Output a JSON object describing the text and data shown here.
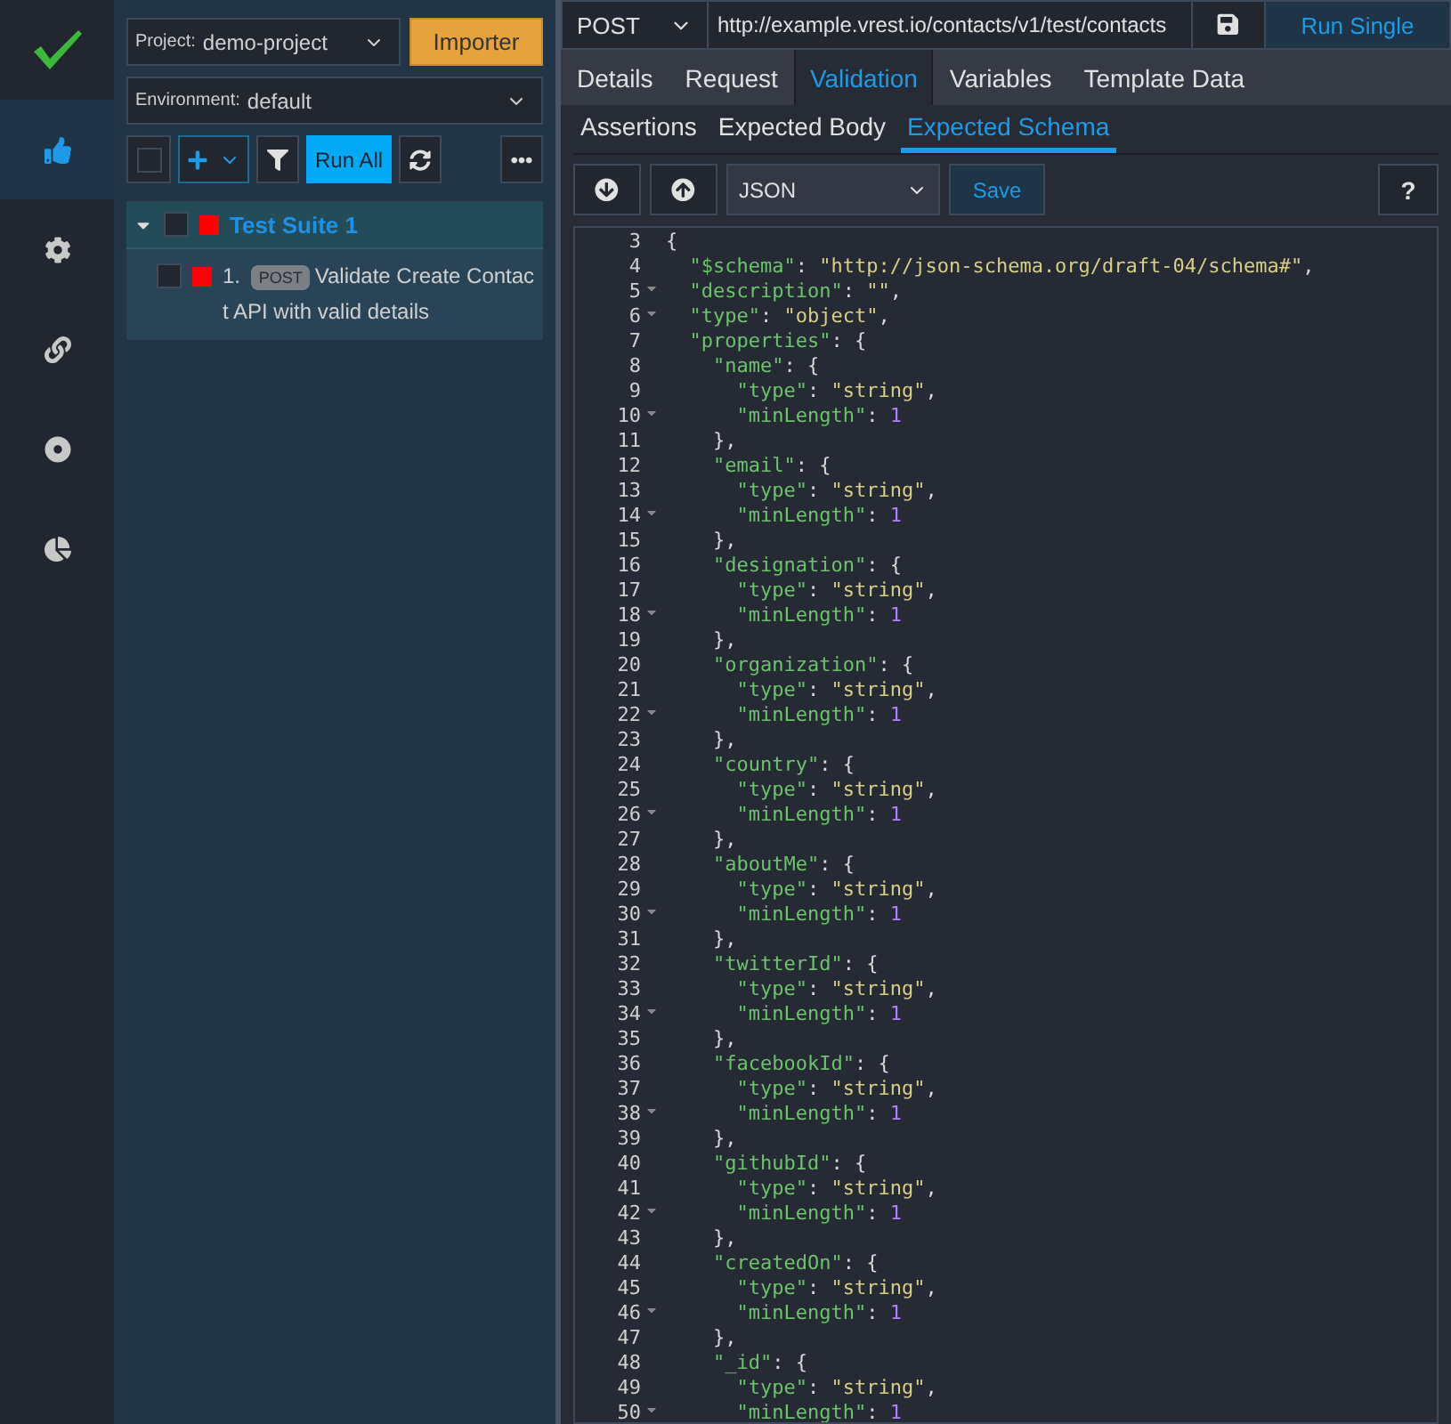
{
  "rail": {
    "items": [
      {
        "kind": "logo",
        "selected": false
      },
      {
        "kind": "thumbs",
        "selected": true
      },
      {
        "kind": "gear",
        "selected": false
      },
      {
        "kind": "link",
        "selected": false
      },
      {
        "kind": "target",
        "selected": false
      },
      {
        "kind": "pie",
        "selected": false
      }
    ]
  },
  "sidebar": {
    "project": {
      "label": "Project:",
      "value": "demo-project"
    },
    "importer": "Importer",
    "environment": {
      "label": "Environment:",
      "value": "default"
    },
    "select_all": {
      "checked": false
    },
    "run_all": "Run All",
    "tree": [
      {
        "label": "Test Suite 1",
        "expanded": true,
        "checked": false,
        "color": "#ff0000",
        "children": [
          {
            "number": "1.",
            "method": "POST",
            "label": "Validate Create Contact API with valid details",
            "checked": false,
            "color": "#ff0000"
          }
        ]
      }
    ]
  },
  "request": {
    "method": "POST",
    "url": "http://example.vrest.io/contacts/v1/test/contacts",
    "run_button": "Run Single"
  },
  "tabs": [
    {
      "label": "Details",
      "selected": false
    },
    {
      "label": "Request",
      "selected": false
    },
    {
      "label": "Validation",
      "selected": true
    },
    {
      "label": "Variables",
      "selected": false
    },
    {
      "label": "Template Data",
      "selected": false
    }
  ],
  "subtabs": [
    {
      "label": "Assertions",
      "selected": false
    },
    {
      "label": "Expected Body",
      "selected": false
    },
    {
      "label": "Expected Schema",
      "selected": true
    }
  ],
  "editor_toolbar": {
    "format": "JSON",
    "save": "Save",
    "help": "?"
  },
  "code": [
    {
      "n": "3",
      "text": "{",
      "fold": false
    },
    {
      "n": "4",
      "text": "  \"$schema\": \"http://json-schema.org/draft-04/schema#\",",
      "fold": false
    },
    {
      "n": "5",
      "text": "  \"description\": \"\",",
      "fold": true
    },
    {
      "n": "6",
      "text": "  \"type\": \"object\",",
      "fold": true
    },
    {
      "n": "7",
      "text": "  \"properties\": {",
      "fold": false
    },
    {
      "n": "8",
      "text": "    \"name\": {",
      "fold": false
    },
    {
      "n": "9",
      "text": "      \"type\": \"string\",",
      "fold": false
    },
    {
      "n": "10",
      "text": "      \"minLength\": 1",
      "fold": true
    },
    {
      "n": "11",
      "text": "    },",
      "fold": false
    },
    {
      "n": "12",
      "text": "    \"email\": {",
      "fold": false
    },
    {
      "n": "13",
      "text": "      \"type\": \"string\",",
      "fold": false
    },
    {
      "n": "14",
      "text": "      \"minLength\": 1",
      "fold": true
    },
    {
      "n": "15",
      "text": "    },",
      "fold": false
    },
    {
      "n": "16",
      "text": "    \"designation\": {",
      "fold": false
    },
    {
      "n": "17",
      "text": "      \"type\": \"string\",",
      "fold": false
    },
    {
      "n": "18",
      "text": "      \"minLength\": 1",
      "fold": true
    },
    {
      "n": "19",
      "text": "    },",
      "fold": false
    },
    {
      "n": "20",
      "text": "    \"organization\": {",
      "fold": false
    },
    {
      "n": "21",
      "text": "      \"type\": \"string\",",
      "fold": false
    },
    {
      "n": "22",
      "text": "      \"minLength\": 1",
      "fold": true
    },
    {
      "n": "23",
      "text": "    },",
      "fold": false
    },
    {
      "n": "24",
      "text": "    \"country\": {",
      "fold": false
    },
    {
      "n": "25",
      "text": "      \"type\": \"string\",",
      "fold": false
    },
    {
      "n": "26",
      "text": "      \"minLength\": 1",
      "fold": true
    },
    {
      "n": "27",
      "text": "    },",
      "fold": false
    },
    {
      "n": "28",
      "text": "    \"aboutMe\": {",
      "fold": false
    },
    {
      "n": "29",
      "text": "      \"type\": \"string\",",
      "fold": false
    },
    {
      "n": "30",
      "text": "      \"minLength\": 1",
      "fold": true
    },
    {
      "n": "31",
      "text": "    },",
      "fold": false
    },
    {
      "n": "32",
      "text": "    \"twitterId\": {",
      "fold": false
    },
    {
      "n": "33",
      "text": "      \"type\": \"string\",",
      "fold": false
    },
    {
      "n": "34",
      "text": "      \"minLength\": 1",
      "fold": true
    },
    {
      "n": "35",
      "text": "    },",
      "fold": false
    },
    {
      "n": "36",
      "text": "    \"facebookId\": {",
      "fold": false
    },
    {
      "n": "37",
      "text": "      \"type\": \"string\",",
      "fold": false
    },
    {
      "n": "38",
      "text": "      \"minLength\": 1",
      "fold": true
    },
    {
      "n": "39",
      "text": "    },",
      "fold": false
    },
    {
      "n": "40",
      "text": "    \"githubId\": {",
      "fold": false
    },
    {
      "n": "41",
      "text": "      \"type\": \"string\",",
      "fold": false
    },
    {
      "n": "42",
      "text": "      \"minLength\": 1",
      "fold": true
    },
    {
      "n": "43",
      "text": "    },",
      "fold": false
    },
    {
      "n": "44",
      "text": "    \"createdOn\": {",
      "fold": false
    },
    {
      "n": "45",
      "text": "      \"type\": \"string\",",
      "fold": false
    },
    {
      "n": "46",
      "text": "      \"minLength\": 1",
      "fold": true
    },
    {
      "n": "47",
      "text": "    },",
      "fold": false
    },
    {
      "n": "48",
      "text": "    \"_id\": {",
      "fold": false
    },
    {
      "n": "49",
      "text": "      \"type\": \"string\",",
      "fold": false
    },
    {
      "n": "50",
      "text": "      \"minLength\": 1",
      "fold": true
    }
  ]
}
